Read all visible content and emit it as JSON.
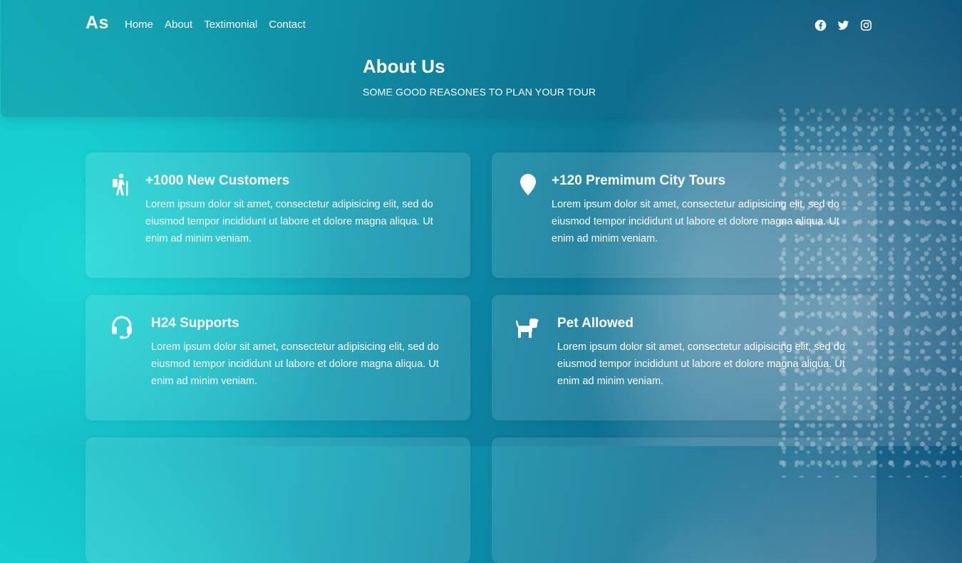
{
  "brand": {
    "logo": "As"
  },
  "nav": {
    "items": [
      {
        "label": "Home"
      },
      {
        "label": "About"
      },
      {
        "label": "Textimonial"
      },
      {
        "label": "Contact"
      }
    ]
  },
  "socials": [
    {
      "icon": "facebook-icon"
    },
    {
      "icon": "twitter-icon"
    },
    {
      "icon": "instagram-icon"
    }
  ],
  "hero": {
    "title": "About Us",
    "subtitle": "SOME GOOD REASONES TO PLAN YOUR TOUR"
  },
  "features": [
    {
      "icon": "hiking-icon",
      "title": "+1000 New Customers",
      "text": "Lorem ipsum dolor sit amet, consectetur adipisicing elit, sed do eiusmod tempor incididunt ut labore et dolore magna aliqua. Ut enim ad minim veniam."
    },
    {
      "icon": "map-marker-icon",
      "title": "+120 Premimum City Tours",
      "text": "Lorem ipsum dolor sit amet, consectetur adipisicing elit, sed do eiusmod tempor incididunt ut labore et dolore magna aliqua. Ut enim ad minim veniam."
    },
    {
      "icon": "headset-icon",
      "title": "H24 Supports",
      "text": "Lorem ipsum dolor sit amet, consectetur adipisicing elit, sed do eiusmod tempor incididunt ut labore et dolore magna aliqua. Ut enim ad minim veniam."
    },
    {
      "icon": "dog-icon",
      "title": "Pet Allowed",
      "text": "Lorem ipsum dolor sit amet, consectetur adipisicing elit, sed do eiusmod tempor incididunt ut labore et dolore magna aliqua. Ut enim ad minim veniam."
    }
  ],
  "colors": {
    "text": "#ffffff",
    "ocean_light": "#13c7cc",
    "ocean_dark": "#0c4f78"
  }
}
